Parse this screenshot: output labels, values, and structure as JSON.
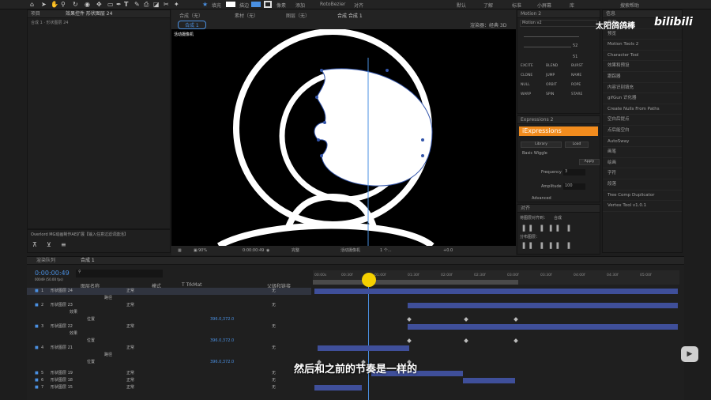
{
  "toolbar": {
    "snap_label": "对齐",
    "fill_label": "填充",
    "stroke_label": "描边",
    "px_label": "像素",
    "add_label": "添加",
    "bezier_label": "RotoBezier"
  },
  "workspaces": [
    {
      "label": "默认",
      "active": true
    },
    {
      "label": "了解",
      "active": false
    },
    {
      "label": "标准",
      "active": false
    },
    {
      "label": "小屏幕",
      "active": false
    },
    {
      "label": "库",
      "active": false
    }
  ],
  "search_help": "搜索帮助",
  "watermark": {
    "channel": "太阳鸽鸽棒",
    "brand": "bilibili"
  },
  "project_panel": {
    "tab_project": "项目",
    "tab_effects": "效果控件 形状图层 24",
    "breadcrumb": "合成 1 · 形状图层 24"
  },
  "viewer": {
    "tab_footage": "素材（无）",
    "tab_layer": "图层（无）",
    "tab_comp": "合成 合成 1",
    "tab_comp_name": "合成 1",
    "tab_comp_label": "合成（无）",
    "renderer": "渲染器：经典 3D",
    "camera_label": "活动摄像机",
    "zoom": "90%",
    "timecode": "0:00:00:49",
    "quality": "完整",
    "camera_select": "活动摄像机",
    "views": "1 个...",
    "offset": "+0.0"
  },
  "motion": {
    "title": "Motion 2",
    "version": "Motion v2",
    "values": [
      "52",
      "51"
    ],
    "buttons": [
      "EXCITE",
      "BLEND",
      "BURST",
      "CLONE",
      "JUMP",
      "NAME",
      "NULL",
      "ORBIT",
      "ROPE",
      "WARP",
      "SPIN",
      "STARE"
    ]
  },
  "expressions": {
    "title": "Expressions 2",
    "brand": "iExpressions",
    "tabs": [
      "Library",
      "Load"
    ],
    "section": "Basic Wiggle",
    "apply": "Apply",
    "frequency_label": "Frequency",
    "frequency_value": "3",
    "amplitude_label": "Amplitude",
    "amplitude_value": "100",
    "advanced": "Advanced"
  },
  "align": {
    "title": "对齐",
    "label": "将图层对齐到：",
    "target": "合成",
    "distribute": "分布图层："
  },
  "right_panel": {
    "header": "信息",
    "items": [
      "音频",
      "预览",
      "Motion Tools 2",
      "Character Tool",
      "效果和预设",
      "跟踪器",
      "内容识别填充",
      "gifGun 识化器",
      "Create Nulls From Paths",
      "空白后提点",
      "点后能空白",
      "AutoSway",
      "画笔",
      "绘画",
      "字符",
      "段落",
      "Tree Comp Duplicator",
      "Vertex Tool v1.0.1"
    ]
  },
  "overlord": {
    "title": "Overlord MG动画制作AE扩展【输入任意过滤词激活】"
  },
  "timeline": {
    "tab_render": "渲染队列",
    "tab_comp": "合成 1",
    "timecode": "0:00:00:49",
    "subtime": "00049 (50.00 fps)",
    "col_name": "图层名称",
    "col_mode": "模式",
    "col_trk": "T TrkMat",
    "col_parent": "父级和链接",
    "ticks": [
      "00:00s",
      "00:30f",
      "01:00f",
      "01:30f",
      "02:00f",
      "02:30f",
      "03:00f",
      "03:30f",
      "04:00f",
      "04:30f",
      "05:00f"
    ]
  },
  "layers": [
    {
      "num": "1",
      "name": "形状图层 24",
      "mode": "正常",
      "parent": "无"
    },
    {
      "num": "",
      "name": "路径",
      "mode": "",
      "parent": ""
    },
    {
      "num": "2",
      "name": "形状图层 23",
      "mode": "正常",
      "parent": "无"
    },
    {
      "num": "",
      "name": "效果",
      "mode": "",
      "parent": ""
    },
    {
      "num": "",
      "name": "位置",
      "mode": "",
      "parent": "",
      "value": "396.0,372.0"
    },
    {
      "num": "3",
      "name": "形状图层 22",
      "mode": "正常",
      "parent": "无"
    },
    {
      "num": "",
      "name": "效果",
      "mode": "",
      "parent": ""
    },
    {
      "num": "",
      "name": "位置",
      "mode": "",
      "parent": "",
      "value": "396.0,372.0"
    },
    {
      "num": "4",
      "name": "形状图层 21",
      "mode": "正常",
      "parent": "无"
    },
    {
      "num": "",
      "name": "路径",
      "mode": "",
      "parent": ""
    },
    {
      "num": "",
      "name": "位置",
      "mode": "",
      "parent": "",
      "value": "396.0,372.0"
    },
    {
      "num": "5",
      "name": "形状图层 19",
      "mode": "正常",
      "parent": "无"
    },
    {
      "num": "6",
      "name": "形状图层 18",
      "mode": "正常",
      "parent": "无"
    },
    {
      "num": "7",
      "name": "形状图层 15",
      "mode": "正常",
      "parent": "无"
    }
  ],
  "subtitle": "然后和之前的节奏是一样的"
}
